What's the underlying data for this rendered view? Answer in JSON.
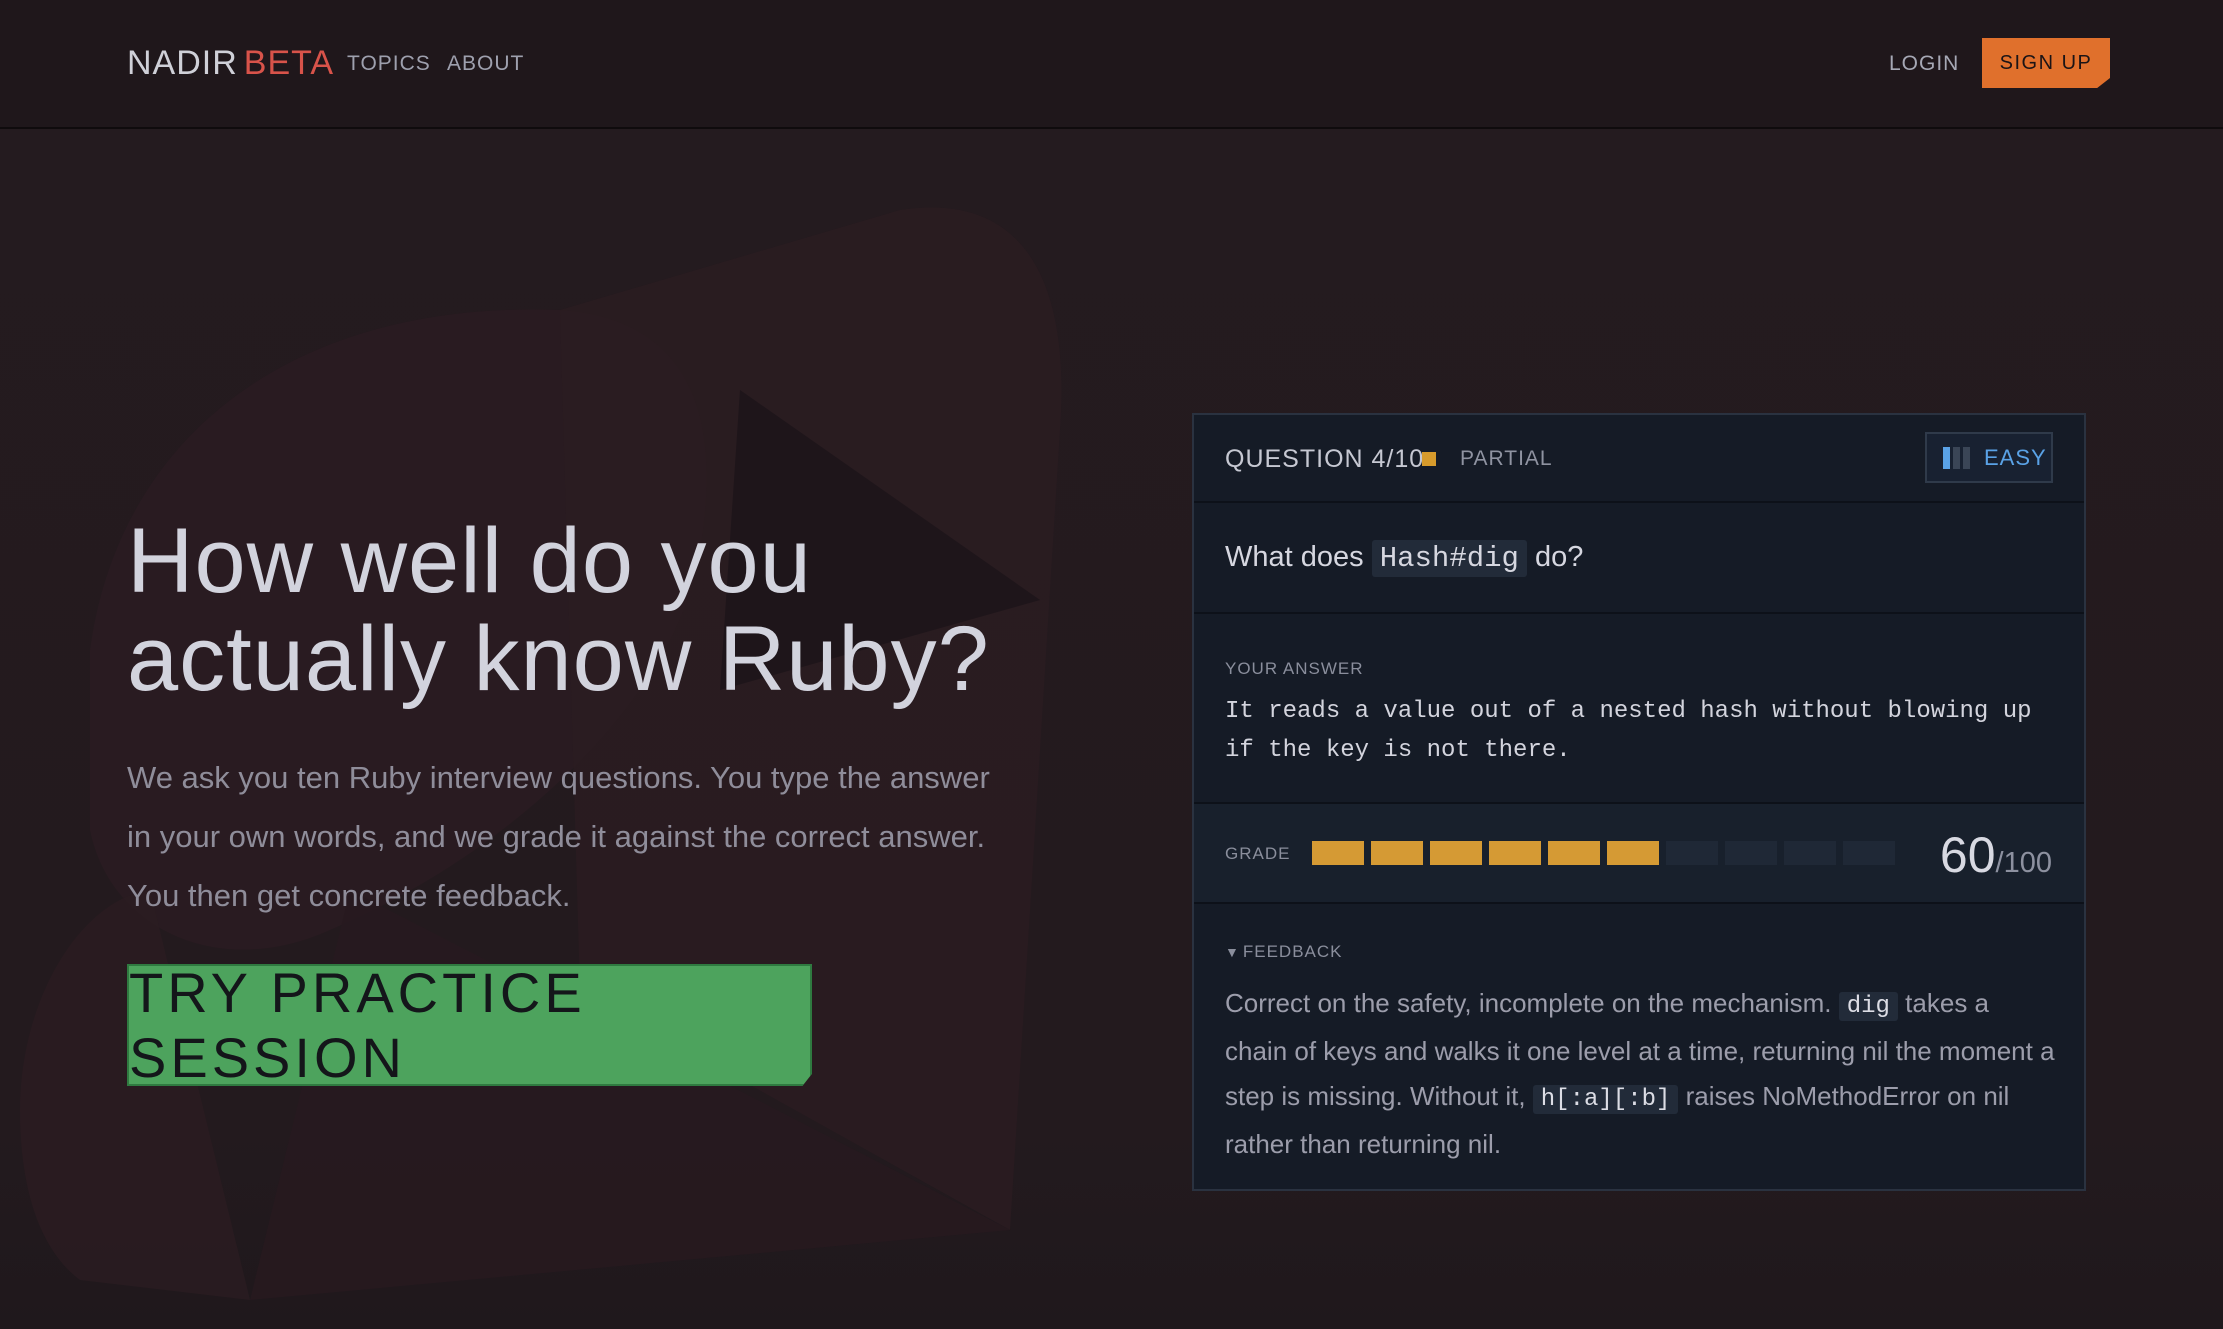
{
  "header": {
    "brand_name": "NADIR",
    "brand_badge": "BETA",
    "nav": {
      "topics": "TOPICS",
      "about": "ABOUT"
    },
    "login": "LOGIN",
    "signup": "SIGN UP"
  },
  "hero": {
    "title_line1": "How well do you",
    "title_line2": "actually know Ruby?",
    "subtitle": "We ask you ten Ruby interview questions. You type the answer in your own words, and we grade it against the correct answer. You then get concrete feedback.",
    "cta": "TRY PRACTICE SESSION"
  },
  "card": {
    "question_counter": "QUESTION 4/10",
    "status": "PARTIAL",
    "status_color": "#d79b2c",
    "difficulty": "EASY",
    "difficulty_color": "#5aa2e6",
    "difficulty_level": 1,
    "difficulty_max": 3,
    "question_prefix": "What does",
    "question_code": "Hash#dig",
    "question_suffix": "do?",
    "answer_label": "YOUR ANSWER",
    "answer": "It reads a value out of a nested hash without blowing up if the key is not there.",
    "grade_label": "GRADE",
    "grade_segments_filled": 6,
    "grade_segments_total": 10,
    "grade_color": "#d59a34",
    "score": "60",
    "score_max": "/100",
    "feedback_label": "FEEDBACK",
    "feedback": {
      "part1": "Correct on the safety, incomplete on the mechanism.",
      "code1": "dig",
      "part2": "takes a chain of keys and walks it one level at a time, returning nil the moment a step is missing. Without it,",
      "code2": "h[:a][:b]",
      "part3": "raises NoMethodError on nil rather than returning nil."
    }
  },
  "colors": {
    "background": "#231a1e",
    "accent_orange": "#e0702c",
    "cta_green": "#4da35d",
    "brand_red": "#d8534a"
  }
}
